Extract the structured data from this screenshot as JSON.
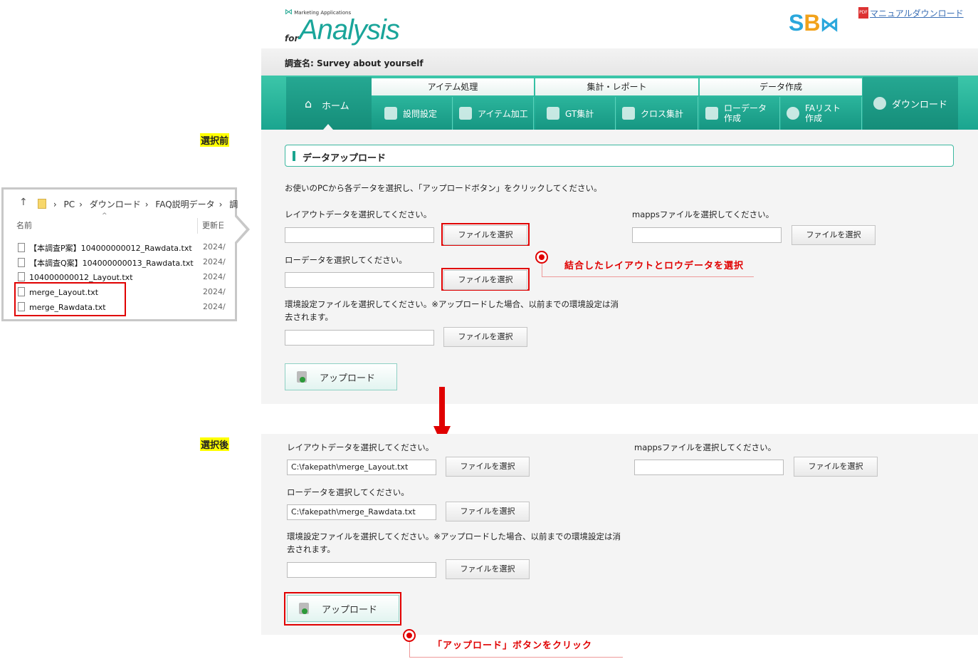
{
  "labels": {
    "before": "選択前",
    "after": "選択後"
  },
  "explorer": {
    "path": [
      "PC",
      "ダウンロード",
      "FAQ説明データ",
      "調"
    ],
    "col_name": "名前",
    "col_date": "更新日",
    "files": [
      {
        "name": "【本調査P案】104000000012_Rawdata.txt",
        "date": "2024/"
      },
      {
        "name": "【本調査Q案】104000000013_Rawdata.txt",
        "date": "2024/"
      },
      {
        "name": "104000000012_Layout.txt",
        "date": "2024/"
      },
      {
        "name": "merge_Layout.txt",
        "date": "2024/"
      },
      {
        "name": "merge_Rawdata.txt",
        "date": "2024/"
      }
    ]
  },
  "header": {
    "logo_small": "Marketing Applications",
    "logo_for": "for",
    "logo_main": "Analysis",
    "sb_logo_s": "S",
    "sb_logo_b": "B",
    "pdf_label": "PDF",
    "manual_link": "マニュアルダウンロード",
    "survey_label": "調査名:",
    "survey_name": "Survey about yourself"
  },
  "nav": {
    "home": "ホーム",
    "groups": [
      "アイテム処理",
      "集計・レポート",
      "データ作成"
    ],
    "items": [
      "設問設定",
      "アイテム加工",
      "GT集計",
      "クロス集計",
      "ローデータ作成",
      "FAリスト作成"
    ],
    "download": "ダウンロード"
  },
  "section": {
    "title": "データアップロード"
  },
  "instructions": "お使いのPCから各データを選択し、「アップロードボタン」をクリックしてください。",
  "form": {
    "layout_label": "レイアウトデータを選択してください。",
    "raw_label": "ローデータを選択してください。",
    "env_label_1": "環境設定ファイルを選択してください。※アップロードした場合、以前までの環境設定は消",
    "env_label_2": "去されます。",
    "mapps_label": "mappsファイルを選択してください。",
    "choose_file": "ファイルを選択",
    "upload": "アップロード"
  },
  "after": {
    "layout_value": "C:\\fakepath\\merge_Layout.txt",
    "raw_value": "C:\\fakepath\\merge_Rawdata.txt"
  },
  "annotations": {
    "select_note": "結合したレイアウトとロウデータを選択",
    "click_note": "「アップロード」ボタンをクリック"
  },
  "colors": {
    "accent": "#1aa58f",
    "highlight_red": "#e00000",
    "label_yellow": "#ffff00"
  }
}
